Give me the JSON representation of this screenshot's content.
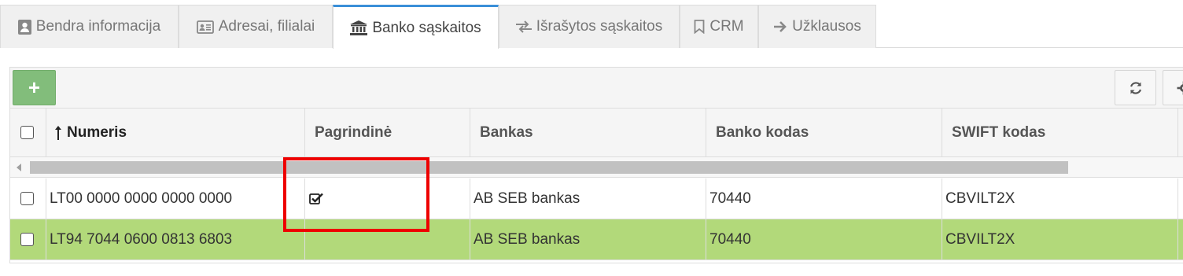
{
  "tabs": [
    {
      "label": "Bendra informacija",
      "icon": "contact-card-icon",
      "active": false
    },
    {
      "label": "Adresai, filialai",
      "icon": "address-card-icon",
      "active": false
    },
    {
      "label": "Banko sąskaitos",
      "icon": "bank-icon",
      "active": true
    },
    {
      "label": "Išrašytos sąskaitos",
      "icon": "exchange-arrows-icon",
      "active": false
    },
    {
      "label": "CRM",
      "icon": "bookmark-icon",
      "active": false
    },
    {
      "label": "Užklausos",
      "icon": "arrow-right-icon",
      "active": false
    }
  ],
  "toolbar": {
    "add_label": "+",
    "refresh_icon": "refresh-icon",
    "settings_icon": "gear-icon"
  },
  "columns": {
    "numeris": "Numeris",
    "pagrindine": "Pagrindinė",
    "bankas": "Bankas",
    "banko_kodas": "Banko kodas",
    "swift": "SWIFT kodas"
  },
  "rows": [
    {
      "numeris": "LT00 0000 0000 0000 0000",
      "pagrindine": true,
      "bankas": "AB SEB bankas",
      "banko_kodas": "70440",
      "swift": "CBVILT2X",
      "selected": false
    },
    {
      "numeris": "LT94 7044 0600 0813 6803",
      "pagrindine": false,
      "bankas": "AB SEB bankas",
      "banko_kodas": "70440",
      "swift": "CBVILT2X",
      "selected": true
    }
  ],
  "colors": {
    "accent_tab": "#3a8fd8",
    "add_button": "#82bd7b",
    "selected_row": "#b2d97a",
    "highlight": "#ee0000"
  }
}
